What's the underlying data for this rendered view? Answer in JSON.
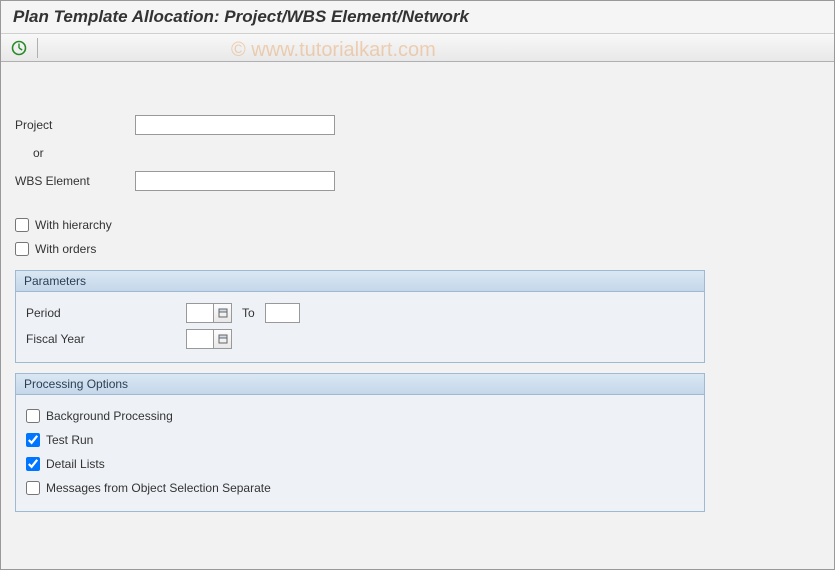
{
  "title": "Plan Template Allocation: Project/WBS Element/Network",
  "watermark": "© www.tutorialkart.com",
  "toolbar": {
    "execute_icon_title": "Execute"
  },
  "selection": {
    "project_label": "Project",
    "project_value": "",
    "or_label": "or",
    "wbs_label": "WBS Element",
    "wbs_value": "",
    "with_hierarchy_label": "With hierarchy",
    "with_hierarchy_checked": false,
    "with_orders_label": "With orders",
    "with_orders_checked": false
  },
  "parameters": {
    "group_title": "Parameters",
    "period_label": "Period",
    "period_from": "",
    "to_label": "To",
    "period_to": "",
    "fiscal_year_label": "Fiscal Year",
    "fiscal_year_value": ""
  },
  "processing": {
    "group_title": "Processing Options",
    "background_label": "Background Processing",
    "background_checked": false,
    "test_run_label": "Test Run",
    "test_run_checked": true,
    "detail_lists_label": "Detail Lists",
    "detail_lists_checked": true,
    "messages_label": "Messages from Object Selection Separate",
    "messages_checked": false
  }
}
